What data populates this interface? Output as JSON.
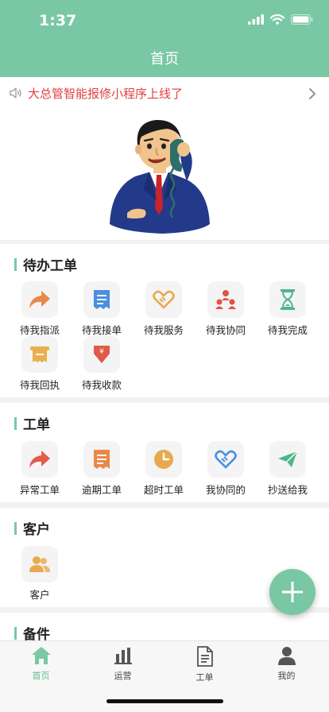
{
  "status_bar": {
    "time": "1:37"
  },
  "header": {
    "title": "首页"
  },
  "notice": {
    "text": "大总管智能报修小程序上线了"
  },
  "sections": {
    "pending": {
      "title": "待办工单",
      "items": [
        {
          "label": "待我指派",
          "icon": "forward-arrow-icon",
          "color": "#e9884a"
        },
        {
          "label": "待我接单",
          "icon": "receipt-icon",
          "color": "#4a8fe0"
        },
        {
          "label": "待我服务",
          "icon": "handshake-icon",
          "color": "#e8a94f"
        },
        {
          "label": "待我协同",
          "icon": "team-icon",
          "color": "#e0533f"
        },
        {
          "label": "待我完成",
          "icon": "hourglass-icon",
          "color": "#4fb58a"
        },
        {
          "label": "待我回执",
          "icon": "receipt-paper-icon",
          "color": "#e8b04f"
        },
        {
          "label": "待我收款",
          "icon": "yen-shield-icon",
          "color": "#e05a4a"
        }
      ]
    },
    "orders": {
      "title": "工单",
      "items": [
        {
          "label": "异常工单",
          "icon": "forward-arrow-icon",
          "color": "#e25c4a"
        },
        {
          "label": "逾期工单",
          "icon": "bill-icon",
          "color": "#e9884a"
        },
        {
          "label": "超时工单",
          "icon": "clock-icon",
          "color": "#e8a94f"
        },
        {
          "label": "我协同的",
          "icon": "handshake-icon",
          "color": "#4a8fe0"
        },
        {
          "label": "抄送给我",
          "icon": "paper-plane-icon",
          "color": "#4fb58a"
        }
      ]
    },
    "customers": {
      "title": "客户",
      "items": [
        {
          "label": "客户",
          "icon": "users-icon",
          "color": "#e8a94f"
        }
      ]
    },
    "parts": {
      "title": "备件"
    }
  },
  "tabbar": {
    "items": [
      {
        "label": "首页",
        "icon": "home-icon",
        "active": true
      },
      {
        "label": "运营",
        "icon": "bar-chart-icon",
        "active": false
      },
      {
        "label": "工单",
        "icon": "document-icon",
        "active": false
      },
      {
        "label": "我的",
        "icon": "user-icon",
        "active": false
      }
    ]
  },
  "colors": {
    "primary": "#79c8a3",
    "notice_text": "#e0403f"
  }
}
